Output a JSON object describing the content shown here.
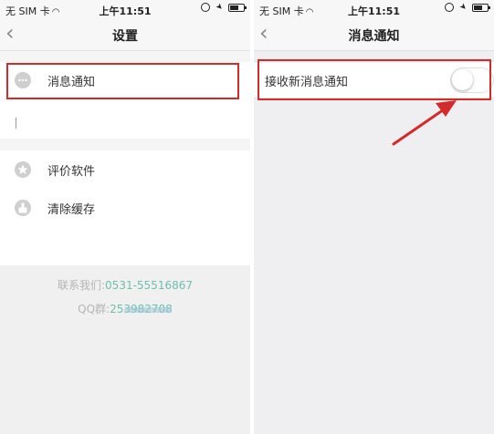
{
  "colors": {
    "highlight": "#d42a2a",
    "contact_value": "#6cbfae",
    "contact_label": "#b5b5b5",
    "arrow": "#d42a2a"
  },
  "left": {
    "status": {
      "carrier": "无 SIM 卡",
      "time": "上午11:51"
    },
    "nav": {
      "back_icon": "chevron-left-icon",
      "title": "设置"
    },
    "items": [
      {
        "label": "消息通知",
        "icon": "chat-bubble-icon"
      },
      {
        "label": "评价软件",
        "icon": "star-icon"
      },
      {
        "label": "清除缓存",
        "icon": "broom-icon"
      }
    ],
    "contact": {
      "phone_label": "联系我们:",
      "phone_value": "0531-55516867",
      "qq_label": "QQ群:",
      "qq_value": "253982708"
    }
  },
  "right": {
    "status": {
      "carrier": "无 SIM 卡",
      "time": "上午11:51"
    },
    "nav": {
      "back_icon": "chevron-left-icon",
      "title": "消息通知"
    },
    "setting": {
      "label": "接收新消息通知",
      "enabled": false
    }
  }
}
